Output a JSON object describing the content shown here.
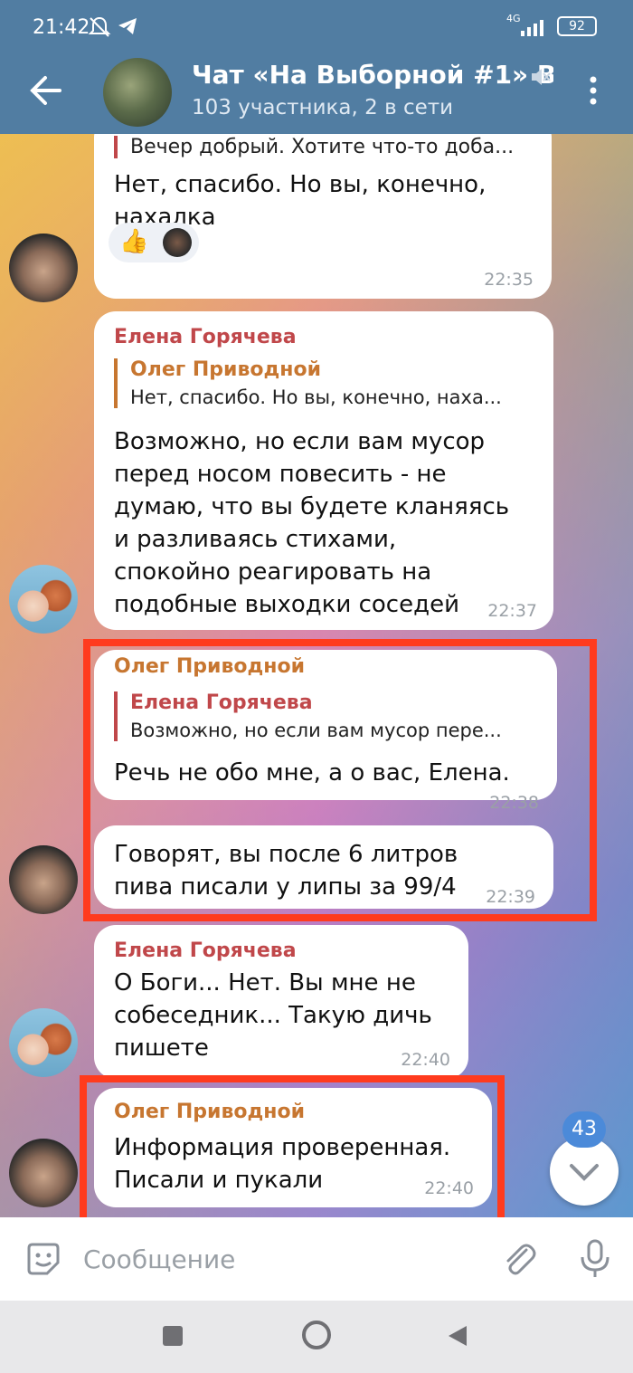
{
  "status_bar": {
    "time": "21:42",
    "network": "4G",
    "battery": "92"
  },
  "header": {
    "title": "Чат «На Выборной #1» В",
    "subtitle": "103 участника, 2 в сети"
  },
  "messages": [
    {
      "reply_text": "Вечер добрый.  Хотите что-то доба...",
      "text": "Нет, спасибо. Но вы, конечно,\nнахалка",
      "time": "22:35",
      "reaction": "👍"
    },
    {
      "sender": "Елена Горячева",
      "reply_name": "Олег Приводной",
      "reply_text": "Нет, спасибо. Но вы, конечно, наха...",
      "text": "Возможно, но если вам мусор\nперед носом повесить - не\nдумаю, что вы будете кланяясь\nи разливаясь стихами,\nспокойно реагировать на\nподобные выходки соседей",
      "time": "22:37"
    },
    {
      "sender": "Олег Приводной",
      "reply_name": "Елена Горячева",
      "reply_text": "Возможно, но если вам мусор пере...",
      "text": "Речь не обо мне, а о вас, Елена.",
      "time": "22:38"
    },
    {
      "text": "Говорят, вы после 6 литров\nпива писали у липы за 99/4",
      "time": "22:39"
    },
    {
      "sender": "Елена Горячева",
      "text": "О Боги... Нет. Вы мне не\nсобеседник... Такую дичь\nпишете",
      "time": "22:40"
    },
    {
      "sender": "Олег Приводной",
      "text": "Информация проверенная.\nПисали и пукали",
      "time": "22:40"
    }
  ],
  "unread_badge": "43",
  "input": {
    "placeholder": "Сообщение"
  },
  "colors": {
    "header": "#517da2",
    "highlight": "#ff3b1e",
    "name_elena": "#c0474a",
    "name_oleg": "#c77630"
  }
}
